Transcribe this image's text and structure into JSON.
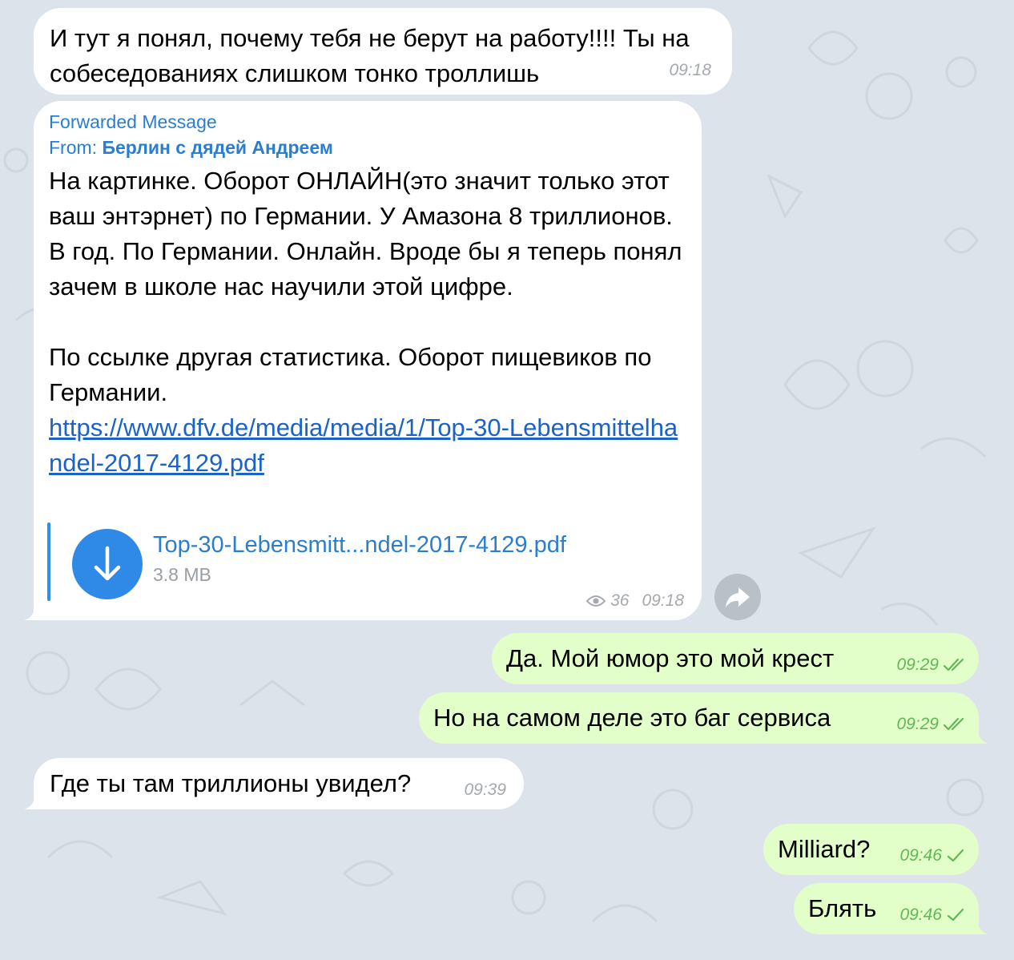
{
  "messages": [
    {
      "text": "И тут я понял, почему тебя не берут на работу!!!! Ты на собеседованиях слишком тонко троллишь",
      "time": "09:18"
    },
    {
      "forward_title": "Forwarded Message",
      "from_label": "From:",
      "from_name": "Берлин с дядей Андреем",
      "paragraph1": "На картинке. Оборот ОНЛАЙН(это значит только этот ваш энтэрнет) по Германии.  У Амазона 8 триллионов. В год. По Германии. Онлайн. Вроде бы я теперь понял зачем в школе нас научили этой цифре.",
      "paragraph2": "По ссылке другая статистика.  Оборот пищевиков по Германии.",
      "link": "https://www.dfv.de/media/media/1/Top-30-Lebensmittelhandel-2017-4129.pdf",
      "file_name": "Top-30-Lebensmitt...ndel-2017-4129.pdf",
      "file_size": "3.8 MB",
      "views": "36",
      "time": "09:18",
      "icons": {
        "download": "download-arrow-icon",
        "views": "eye-icon",
        "share": "share-arrow-icon"
      }
    },
    {
      "text": "Да. Мой юмор это мой крест",
      "time": "09:29",
      "status": "read"
    },
    {
      "text": "Но на самом деле это баг сервиса",
      "time": "09:29",
      "status": "read"
    },
    {
      "text": "Где ты там триллионы увидел?",
      "time": "09:39"
    },
    {
      "text": "Milliard?",
      "time": "09:46",
      "status": "sent"
    },
    {
      "text": "Блять",
      "time": "09:46",
      "status": "sent"
    }
  ],
  "colors": {
    "background": "#dde3ea",
    "incoming_bubble": "#ffffff",
    "outgoing_bubble": "#e2fec9",
    "accent": "#2a7ed1",
    "outgoing_meta": "#63b757"
  }
}
